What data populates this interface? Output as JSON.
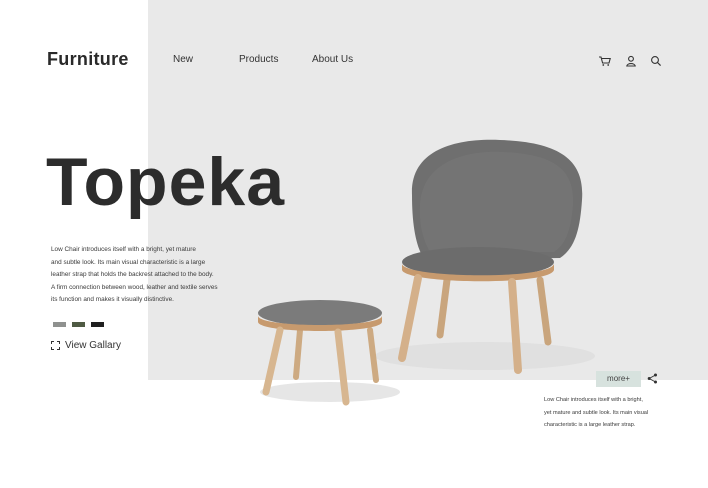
{
  "brand": {
    "logo": "Furniture"
  },
  "nav": {
    "new": "New",
    "products": "Products",
    "about": "About Us"
  },
  "toolbar": {
    "icons": [
      "cart-icon",
      "user-icon",
      "search-icon"
    ]
  },
  "hero": {
    "title": "Topeka",
    "description_lines": [
      "Low Chair introduces itself with a bright, yet mature",
      "and subtle look. Its main visual characteristic is a large",
      "leather strap that holds the backrest attached to the body.",
      "A firm connection between wood, leather and textile serves",
      "its function and makes it visually distinctive."
    ],
    "swatches": [
      "#8f918f",
      "#4f5a43",
      "#1f1f1f"
    ],
    "gallery_label": "View Gallary"
  },
  "detail": {
    "more_label": "more+",
    "description_lines": [
      "Low Chair introduces itself with a bright,",
      "yet mature  and subtle look. Its main visual",
      "characteristic is a large leather strap."
    ]
  },
  "colors": {
    "accent": "#d7e2de",
    "background": "#e9e9e9",
    "panel": "#ffffff"
  }
}
